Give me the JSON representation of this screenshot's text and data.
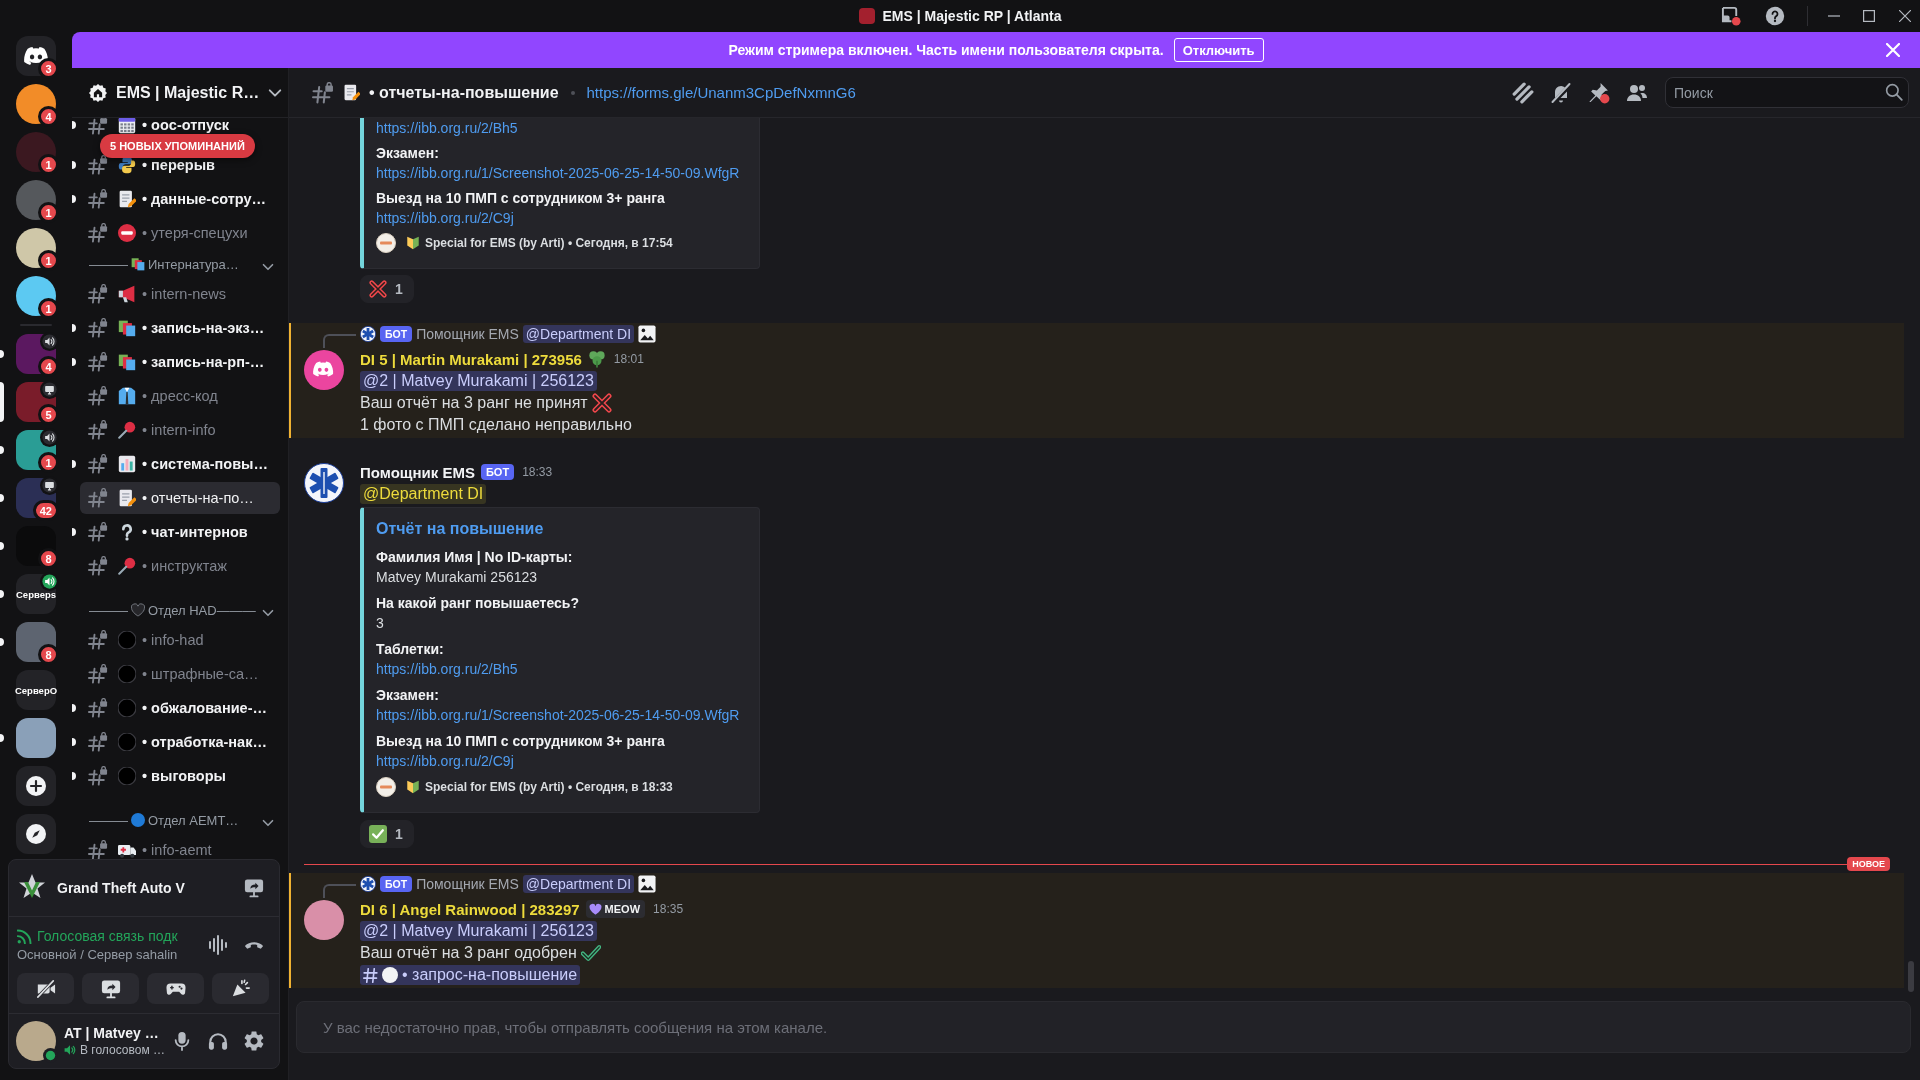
{
  "window": {
    "title": "EMS | Majestic RP | Atlanta"
  },
  "banner": {
    "text": "Режим стримера включен. Часть имени пользователя скрыта.",
    "button": "Отключить"
  },
  "servers": [
    {
      "kind": "home",
      "badge": "3",
      "unread": false,
      "selected": false
    },
    {
      "kind": "dm",
      "badge": "4",
      "unread": false,
      "selected": false
    },
    {
      "kind": "dm",
      "badge": "1",
      "unread": false,
      "selected": false
    },
    {
      "kind": "dm",
      "badge": "1",
      "unread": false,
      "selected": false
    },
    {
      "kind": "dm",
      "badge": "1",
      "unread": false,
      "selected": false
    },
    {
      "kind": "dm",
      "badge": "1",
      "unread": false,
      "selected": false
    },
    {
      "kind": "server",
      "badge": "4",
      "activity": {
        "kind": "voice"
      },
      "unread": true,
      "selected": false
    },
    {
      "kind": "server",
      "badge": "5",
      "activity": {
        "kind": "screen"
      },
      "unread": false,
      "selected": true
    },
    {
      "kind": "server",
      "badge": "1",
      "activity": {
        "kind": "voice"
      },
      "unread": true,
      "selected": false
    },
    {
      "kind": "server",
      "badge": "42",
      "activity": {
        "kind": "screen"
      },
      "unread": true,
      "selected": false
    },
    {
      "kind": "server",
      "badge": "8",
      "unread": true,
      "selected": false
    },
    {
      "kind": "server",
      "label": "Серверs",
      "activity": {
        "kind": "voice-joined"
      },
      "unread": true,
      "selected": false
    },
    {
      "kind": "server",
      "badge": "8",
      "unread": true,
      "selected": false
    },
    {
      "kind": "server",
      "label": "СерверО",
      "unread": false,
      "selected": false
    },
    {
      "kind": "server",
      "unread": true,
      "selected": false
    },
    {
      "kind": "add",
      "unread": false,
      "selected": false
    },
    {
      "kind": "discover",
      "unread": false,
      "selected": false
    }
  ],
  "sidebar": {
    "server_name": "EMS | Majestic R…",
    "mentions_pill": "5 НОВЫХ УПОМИНАНИЙ",
    "sections": [
      {
        "channels": [
          {
            "name": "• ooc-отпуск",
            "unread": true,
            "selected": false
          },
          {
            "name": "• перерыв",
            "unread": true,
            "selected": false
          },
          {
            "name": "• данные-сотру…",
            "unread": true,
            "selected": false
          },
          {
            "name": "• утеря-спецухи",
            "unread": false,
            "selected": false
          }
        ]
      },
      {
        "lead": "———",
        "name": "Интернатура…",
        "expanded": true,
        "channels": [
          {
            "name": "• intern-news",
            "unread": false,
            "selected": false
          },
          {
            "name": "• запись-на-экз…",
            "unread": true,
            "selected": false
          },
          {
            "name": "• запись-на-рп-…",
            "unread": true,
            "selected": false
          },
          {
            "name": "• дресс-код",
            "unread": false,
            "selected": false
          },
          {
            "name": "• intern-info",
            "unread": false,
            "selected": false
          },
          {
            "name": "• система-повы…",
            "unread": true,
            "selected": false
          },
          {
            "name": "• отчеты-на-по…",
            "unread": false,
            "selected": true
          },
          {
            "name": "• чат-интернов",
            "unread": true,
            "selected": false
          },
          {
            "name": "• инструктаж",
            "unread": false,
            "selected": false
          }
        ]
      },
      {
        "lead": "———",
        "name": "Отдел HAD———",
        "expanded": true,
        "channels": [
          {
            "name": "• info-had",
            "unread": false,
            "selected": false
          },
          {
            "name": "• штрафные-са…",
            "unread": false,
            "selected": false
          },
          {
            "name": "• обжалование-…",
            "unread": true,
            "selected": false
          },
          {
            "name": "• отработка-нак…",
            "unread": true,
            "selected": false
          },
          {
            "name": "• выговоры",
            "unread": true,
            "selected": false
          }
        ]
      },
      {
        "lead": "———",
        "name": "Отдел AEMT…",
        "expanded": true,
        "channels": [
          {
            "name": "• info-aemt",
            "unread": false,
            "selected": false
          }
        ]
      }
    ]
  },
  "user_panel": {
    "activity": {
      "title": "Grand Theft Auto V"
    },
    "voice": {
      "status": "Голосовая связь подк",
      "channel": "Основной / Сервер sahalin"
    },
    "user": {
      "name": "AT | Matvey …",
      "status": "В голосовом …"
    }
  },
  "channel_header": {
    "name": "• отчеты-на-повышение",
    "topic": "https://forms.gle/Unanm3CpDefNxmnG6",
    "search": {
      "placeholder": "Поиск"
    }
  },
  "messages": [
    {
      "kind": "continuation",
      "highlighted": false,
      "embed": {
        "fields": [
          {
            "value": "https://ibb.org.ru/2/Bh5",
            "link": true
          },
          {
            "name": "Экзамен:",
            "value": "https://ibb.org.ru/1/Screenshot-2025-06-25-14-50-09.WfgR",
            "link": true
          },
          {
            "name": "Выезд на 10 ПМП с сотрудником 3+ ранга",
            "value": "https://ibb.org.ru/2/C9j",
            "link": true
          }
        ],
        "footer": "Special for EMS (by Arti) • Сегодня, в 17:54"
      },
      "reactions": [
        {
          "kind": "cross",
          "count": "1"
        }
      ]
    },
    {
      "kind": "message",
      "highlighted": true,
      "reply": {
        "badge": "БОТ",
        "author": "Помощник EMS",
        "mention": "@Department DI"
      },
      "author": {
        "name": "DI 5 | Martin Murakami | 273956",
        "color": "#eddb3c"
      },
      "role_icon": true,
      "time": "18:01",
      "lines": [
        {
          "kind": "mention",
          "text": "@2 | Matvey Murakami | 256123"
        },
        {
          "kind": "text",
          "text": "Ваш отчёт на 3 ранг не принят",
          "emoji": {
            "kind": "cross"
          }
        },
        {
          "kind": "text",
          "text": "1 фото с ПМП сделано неправильно"
        }
      ]
    },
    {
      "kind": "message",
      "highlighted": false,
      "author": {
        "name": "Помощник EMS",
        "color": "#f2f3f5"
      },
      "role_icon": false,
      "tag": {
        "kind": "bot",
        "text": "БОТ"
      },
      "time": "18:33",
      "lines": [
        {
          "kind": "role-mention",
          "text": "@Department DI",
          "color": "#eddb3c"
        }
      ],
      "embed": {
        "title": "Отчёт на повышение",
        "fields": [
          {
            "name": "Фамилия Имя | No ID-карты:",
            "value": "Matvey Murakami 256123",
            "link": false
          },
          {
            "name": "На какой ранг повышаетесь?",
            "value": "3",
            "link": false
          },
          {
            "name": "Таблетки:",
            "value": "https://ibb.org.ru/2/Bh5",
            "link": true
          },
          {
            "name": "Экзамен:",
            "value": "https://ibb.org.ru/1/Screenshot-2025-06-25-14-50-09.WfgR",
            "link": true
          },
          {
            "name": "Выезд на 10 ПМП с сотрудником 3+ ранга",
            "value": "https://ibb.org.ru/2/C9j",
            "link": true
          }
        ],
        "footer": "Special for EMS (by Arti) • Сегодня, в 18:33"
      },
      "reactions": [
        {
          "kind": "check",
          "count": "1"
        }
      ]
    },
    {
      "kind": "divider",
      "label": "НОВОЕ"
    },
    {
      "kind": "message",
      "highlighted": true,
      "reply": {
        "badge": "БОТ",
        "author": "Помощник EMS",
        "mention": "@Department DI"
      },
      "author": {
        "name": "DI 6 | Angel Rainwood | 283297",
        "color": "#eddb3c"
      },
      "role_icon": false,
      "tag": {
        "kind": "guild",
        "text": "MEOW"
      },
      "time": "18:35",
      "lines": [
        {
          "kind": "mention",
          "text": "@2 | Matvey Murakami | 256123"
        },
        {
          "kind": "text",
          "text": "Ваш отчёт на 3 ранг одобрен",
          "emoji": {
            "kind": "check"
          }
        },
        {
          "kind": "channel-mention",
          "text": "• запрос-на-повышение"
        }
      ]
    }
  ],
  "composer": {
    "notice": "У вас недостаточно прав, чтобы отправлять сообщения на этом канале."
  }
}
